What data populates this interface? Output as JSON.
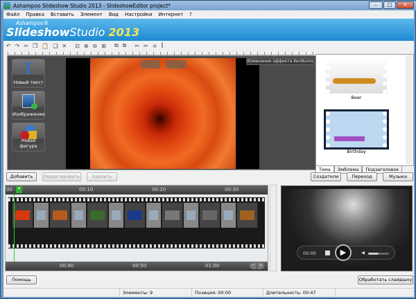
{
  "window": {
    "title": "Ashampoo Slideshow Studio 2013 - SlideshowEditor project*",
    "min": "–",
    "max": "□",
    "close": "✕"
  },
  "menu": [
    "Файл",
    "Правка",
    "Вставить",
    "Элемент",
    "Вид",
    "Настройки",
    "Интернет",
    "?"
  ],
  "banner": {
    "vendor": "Ashampoo®",
    "product_bold": "Slideshow",
    "product": "Studio",
    "year": "2013"
  },
  "toolbar": [
    "undo-icon",
    "redo-icon",
    "cut-icon",
    "copy-icon",
    "paste-icon",
    "duplicate-icon",
    "delete-icon",
    "zoom-fit-icon",
    "zoom-in-icon",
    "zoom-out-icon",
    "zoom-full-icon",
    "group-icon",
    "ungroup-icon",
    "split-icon",
    "trim-icon",
    "align-vertical-icon",
    "align-horizontal-icon"
  ],
  "toolbar_glyphs": [
    "↶",
    "↷",
    "✂",
    "❐",
    "📋",
    "❑",
    "✕",
    "⊡",
    "⊕",
    "⊖",
    "⊞",
    "⧉",
    "⧉",
    "✂",
    "✂",
    "≑",
    "⫿"
  ],
  "editor": {
    "tools": [
      {
        "label": "Новый текст",
        "icon": "text-icon"
      },
      {
        "label": "Изображение",
        "icon": "image-icon"
      },
      {
        "label": "Новая фигура",
        "icon": "shape-icon"
      }
    ],
    "kenburns": "Изменение эффекта KenBurns"
  },
  "themes": {
    "items": [
      "Beer",
      "Birthday"
    ],
    "tabs": [
      "Тема",
      "Эмблема",
      "Подзаголовок"
    ]
  },
  "buttons": {
    "add": "Добавить",
    "edit": "Редактировать",
    "delete": "Удалить",
    "credits": "Создатели",
    "transition": "Переход",
    "music": "Музыка",
    "help": "Помощь",
    "render": "Обработать слайдшоу"
  },
  "timeline": {
    "top_ticks": [
      "00",
      "00:10",
      "00:20",
      "00:30"
    ],
    "bottom_ticks": [
      "00:40",
      "00:50",
      "01:00"
    ],
    "zoom_out": "−",
    "zoom_in": "+"
  },
  "clips": [
    "photo",
    "transition",
    "photo",
    "transition",
    "photo",
    "transition",
    "photo",
    "transition",
    "photo",
    "transition",
    "photo",
    "transition",
    "photo"
  ],
  "clip_colors": [
    "#d6380f",
    "#9ab",
    "#b65a20",
    "#9ab",
    "#3a6a2a",
    "#9ab",
    "#1c3a8a",
    "#9ab",
    "#777",
    "#9ab",
    "#666",
    "#9ab",
    "#a06020"
  ],
  "player": {
    "time": "00:00",
    "volume": 0.5
  },
  "status": {
    "elements": "Элементы: 9",
    "position": "Позиция: 00:00",
    "duration": "Длительность: 00:47"
  }
}
